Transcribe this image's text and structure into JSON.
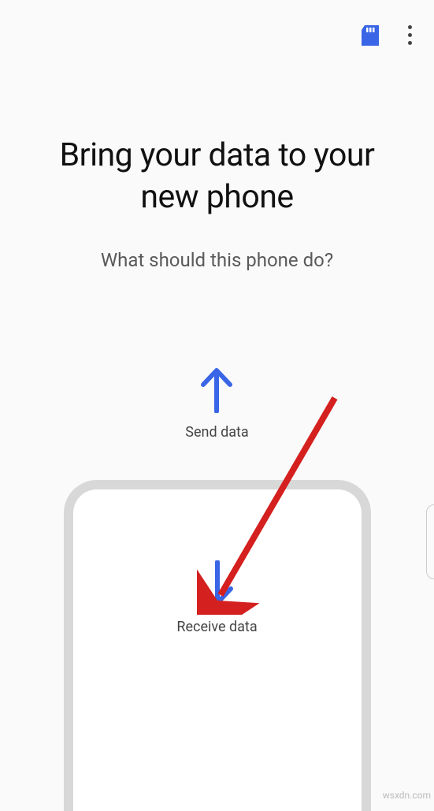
{
  "toolbar": {
    "sd_icon": "sd-card",
    "more_icon": "more-vertical"
  },
  "header": {
    "title": "Bring your data to your new phone",
    "subtitle": "What should this phone do?"
  },
  "options": {
    "send": {
      "label": "Send data",
      "icon": "arrow-up"
    },
    "receive": {
      "label": "Receive data",
      "icon": "arrow-down"
    }
  },
  "colors": {
    "accent": "#3965e6",
    "annotation": "#d4201f"
  },
  "watermark": "wsxdn.com"
}
